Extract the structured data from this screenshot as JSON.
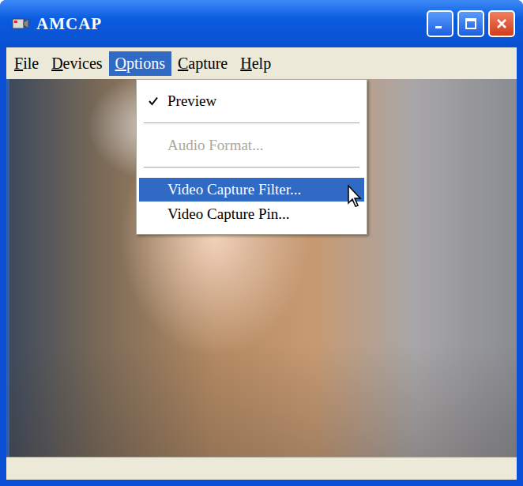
{
  "window": {
    "title": "AMCAP"
  },
  "menubar": [
    {
      "label": "File",
      "selected": false
    },
    {
      "label": "Devices",
      "selected": false
    },
    {
      "label": "Options",
      "selected": true
    },
    {
      "label": "Capture",
      "selected": false
    },
    {
      "label": "Help",
      "selected": false
    }
  ],
  "options_menu": {
    "items": [
      {
        "kind": "item",
        "label": "Preview",
        "checked": true,
        "disabled": false,
        "highlighted": false
      },
      {
        "kind": "separator"
      },
      {
        "kind": "item",
        "label": "Audio Format...",
        "checked": false,
        "disabled": true,
        "highlighted": false
      },
      {
        "kind": "separator"
      },
      {
        "kind": "item",
        "label": "Video Capture Filter...",
        "checked": false,
        "disabled": false,
        "highlighted": true
      },
      {
        "kind": "item",
        "label": "Video Capture Pin...",
        "checked": false,
        "disabled": false,
        "highlighted": false
      }
    ]
  }
}
